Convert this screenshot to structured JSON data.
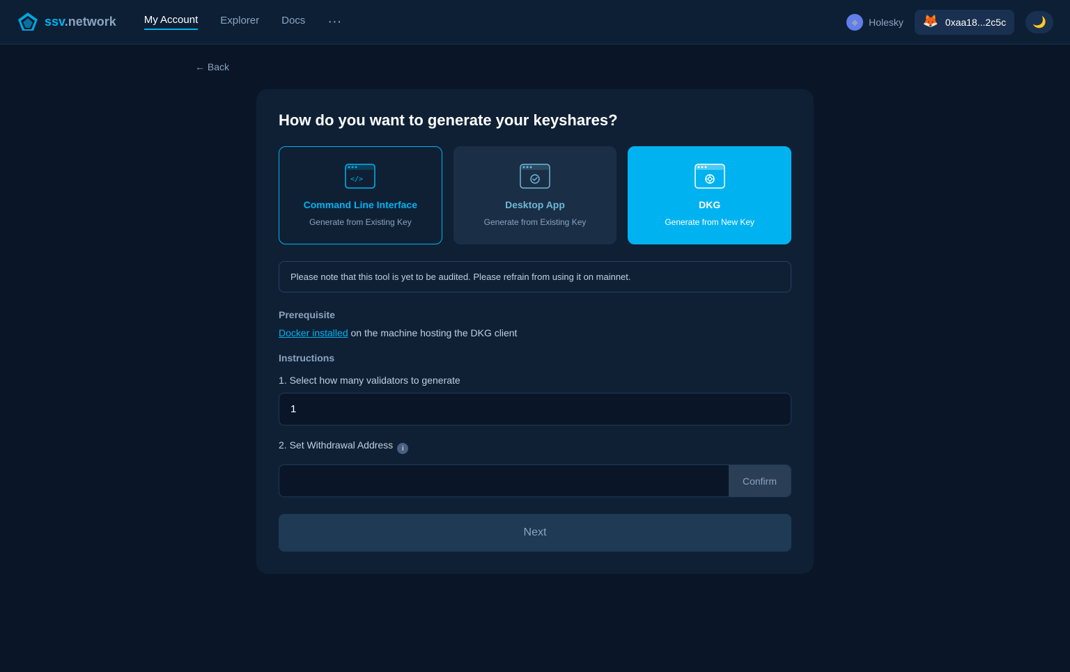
{
  "navbar": {
    "logo_text": "ssv",
    "logo_suffix": ".network",
    "links": [
      {
        "label": "My Account",
        "active": true
      },
      {
        "label": "Explorer",
        "active": false
      },
      {
        "label": "Docs",
        "active": false
      }
    ],
    "dots": "···",
    "network": "Holesky",
    "wallet_address": "0xaa18...2c5c",
    "theme_icon": "🌙"
  },
  "back": {
    "label": "← Back"
  },
  "card": {
    "title": "How do you want to generate your keyshares?",
    "options": [
      {
        "id": "cli",
        "title": "Command Line Interface",
        "subtitle": "Generate from Existing Key",
        "state": "cli"
      },
      {
        "id": "desktop",
        "title": "Desktop App",
        "subtitle": "Generate from Existing Key",
        "state": "desktop"
      },
      {
        "id": "dkg",
        "title": "DKG",
        "subtitle": "Generate from New Key",
        "state": "selected"
      }
    ],
    "warning": "Please note that this tool is yet to be audited. Please refrain from using it on mainnet.",
    "prerequisite_label": "Prerequisite",
    "prerequisite_link": "Docker installed",
    "prerequisite_suffix": " on the machine hosting the DKG client",
    "instructions_label": "Instructions",
    "step1_label": "1. Select how many validators to generate",
    "step1_value": "1",
    "step1_placeholder": "1",
    "step2_label": "2. Set Withdrawal Address",
    "confirm_btn_label": "Confirm",
    "confirm_placeholder": "",
    "next_btn_label": "Next"
  }
}
